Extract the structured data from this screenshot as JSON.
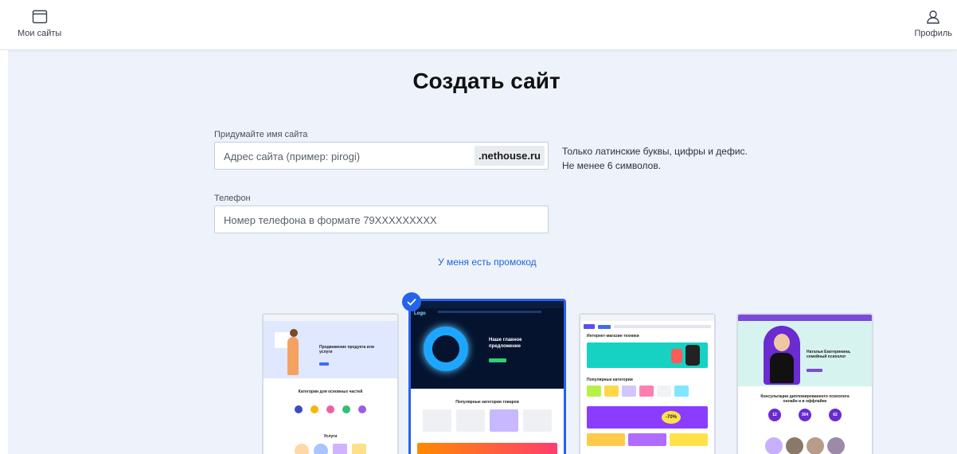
{
  "header": {
    "my_sites_label": "Мои сайты",
    "profile_label": "Профиль"
  },
  "page": {
    "title": "Создать сайт"
  },
  "form": {
    "site_name_label": "Придумайте имя сайта",
    "site_name_placeholder": "Адрес сайта (пример: pirogi)",
    "domain_suffix": ".nethouse.ru",
    "hint_line1": "Только латинские буквы, цифры и дефис.",
    "hint_line2": "Не менее 6 символов.",
    "phone_label": "Телефон",
    "phone_placeholder": "Номер телефона в формате 79XXXXXXXXX",
    "promo_link": "У меня есть промокод"
  },
  "templates": [
    {
      "name": "template-services",
      "heading": "Продвижение продукта или услуги",
      "section": "Категории для основных частей",
      "section2": "Услуги",
      "selected": false
    },
    {
      "name": "template-store",
      "logo": "Logo",
      "heading1": "Наше главное",
      "heading2": "предложение",
      "section": "Популярные категории товаров",
      "selected": true
    },
    {
      "name": "template-marketplace",
      "section": "Интернет-магазин техники",
      "section2": "Популярные категории",
      "promo": "-70%",
      "selected": false
    },
    {
      "name": "template-psychologist",
      "heading": "Наталья Екатеринина, семейный психолог",
      "section": "Консультации дипломированного психолога онлайн и в оффлайне",
      "stats": [
        "12",
        "304",
        "62"
      ],
      "selected": false
    }
  ],
  "colors": {
    "accent": "#2563eb",
    "link": "#1e63d6",
    "page_bg": "#eef3fb"
  }
}
